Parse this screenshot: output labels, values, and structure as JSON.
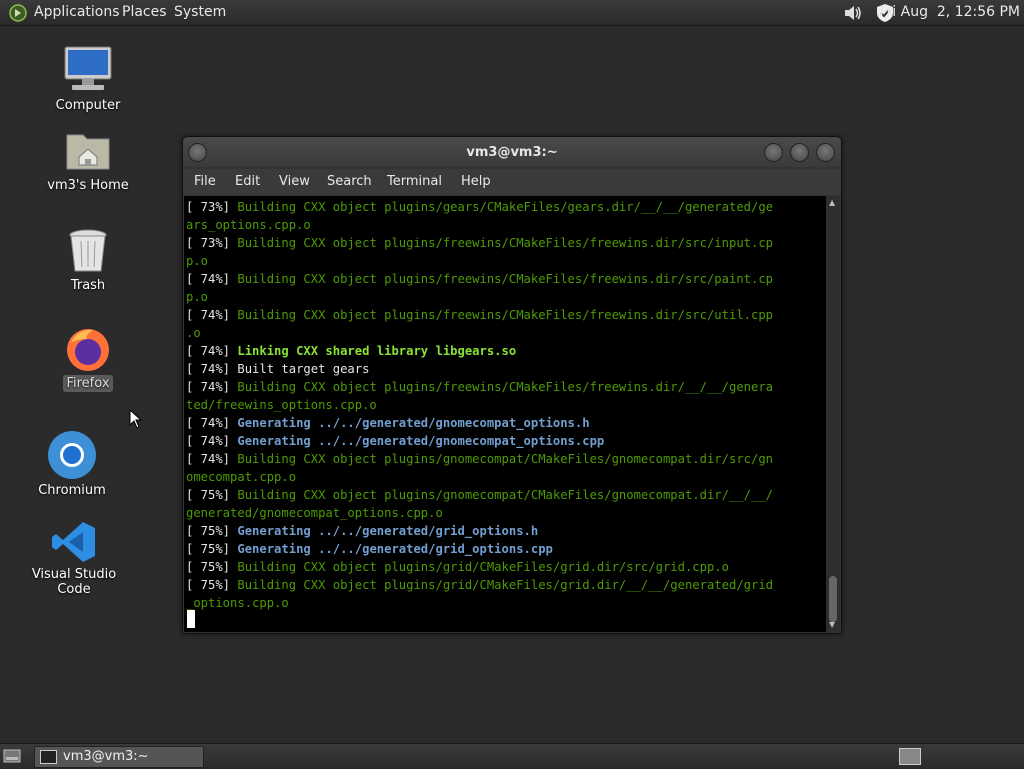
{
  "top_panel": {
    "menus": [
      "Applications",
      "Places",
      "System"
    ],
    "clock": "Fri Aug  2, 12:56 PM",
    "tray_icons": [
      "volume-icon",
      "shield-update-icon"
    ]
  },
  "desktop": {
    "icons": [
      {
        "label": "Computer",
        "icon": "computer-icon"
      },
      {
        "label": "vm3's Home",
        "icon": "home-folder-icon"
      },
      {
        "label": "Trash",
        "icon": "trash-icon"
      },
      {
        "label": "Firefox",
        "icon": "firefox-icon",
        "selected": true
      },
      {
        "label": "Chromium",
        "icon": "chromium-icon"
      },
      {
        "label": "Visual Studio Code",
        "icon": "vscode-icon"
      }
    ]
  },
  "window": {
    "title": "vm3@vm3:~",
    "menu": [
      "File",
      "Edit",
      "View",
      "Search",
      "Terminal",
      "Help"
    ],
    "terminal_lines": [
      {
        "pct": "[ 73%] ",
        "text": "Building CXX object plugins/gears/CMakeFiles/gears.dir/__/__/generated/ge",
        "style": "g"
      },
      {
        "pct": "",
        "text": "ars_options.cpp.o",
        "style": "g"
      },
      {
        "pct": "[ 73%] ",
        "text": "Building CXX object plugins/freewins/CMakeFiles/freewins.dir/src/input.cp",
        "style": "g"
      },
      {
        "pct": "",
        "text": "p.o",
        "style": "g"
      },
      {
        "pct": "[ 74%] ",
        "text": "Building CXX object plugins/freewins/CMakeFiles/freewins.dir/src/paint.cp",
        "style": "g"
      },
      {
        "pct": "",
        "text": "p.o",
        "style": "g"
      },
      {
        "pct": "[ 74%] ",
        "text": "Building CXX object plugins/freewins/CMakeFiles/freewins.dir/src/util.cpp",
        "style": "g"
      },
      {
        "pct": "",
        "text": ".o",
        "style": "g"
      },
      {
        "pct": "[ 74%] ",
        "text": "Linking CXX shared library libgears.so",
        "style": "bg"
      },
      {
        "pct": "[ 74%] ",
        "text": "Built target gears",
        "style": "w"
      },
      {
        "pct": "[ 74%] ",
        "text": "Building CXX object plugins/freewins/CMakeFiles/freewins.dir/__/__/genera",
        "style": "g"
      },
      {
        "pct": "",
        "text": "ted/freewins_options.cpp.o",
        "style": "g"
      },
      {
        "pct": "[ 74%] ",
        "text": "Generating ../../generated/gnomecompat_options.h",
        "style": "bb"
      },
      {
        "pct": "[ 74%] ",
        "text": "Generating ../../generated/gnomecompat_options.cpp",
        "style": "bb"
      },
      {
        "pct": "[ 74%] ",
        "text": "Building CXX object plugins/gnomecompat/CMakeFiles/gnomecompat.dir/src/gn",
        "style": "g"
      },
      {
        "pct": "",
        "text": "omecompat.cpp.o",
        "style": "g"
      },
      {
        "pct": "[ 75%] ",
        "text": "Building CXX object plugins/gnomecompat/CMakeFiles/gnomecompat.dir/__/__/",
        "style": "g"
      },
      {
        "pct": "",
        "text": "generated/gnomecompat_options.cpp.o",
        "style": "g"
      },
      {
        "pct": "[ 75%] ",
        "text": "Generating ../../generated/grid_options.h",
        "style": "bb"
      },
      {
        "pct": "[ 75%] ",
        "text": "Generating ../../generated/grid_options.cpp",
        "style": "bb"
      },
      {
        "pct": "[ 75%] ",
        "text": "Building CXX object plugins/grid/CMakeFiles/grid.dir/src/grid.cpp.o",
        "style": "g"
      },
      {
        "pct": "[ 75%] ",
        "text": "Building CXX object plugins/grid/CMakeFiles/grid.dir/__/__/generated/grid",
        "style": "g"
      },
      {
        "pct": "",
        "text": "_options.cpp.o",
        "style": "g"
      }
    ]
  },
  "bottom_panel": {
    "task_label": "vm3@vm3:~"
  }
}
